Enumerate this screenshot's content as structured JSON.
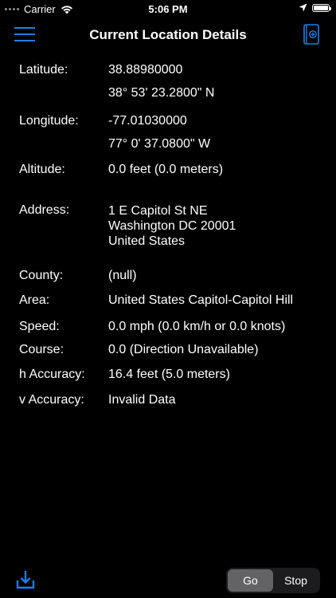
{
  "status_bar": {
    "carrier": "Carrier",
    "time": "5:06 PM",
    "icons": [
      "signal-dots-icon",
      "wifi-icon",
      "location-arrow-icon",
      "battery-icon"
    ]
  },
  "nav": {
    "title": "Current Location Details",
    "left_icon": "menu-icon",
    "right_icon": "add-bookmark-icon",
    "accent_color": "#1e7cf0"
  },
  "details": {
    "latitude": {
      "label": "Latitude:",
      "decimal": "38.88980000",
      "dms": "38° 53' 23.2800\" N"
    },
    "longitude": {
      "label": "Longitude:",
      "decimal": "-77.01030000",
      "dms": "77° 0' 37.0800\" W"
    },
    "altitude": {
      "label": "Altitude:",
      "value": "0.0 feet (0.0 meters)"
    },
    "address": {
      "label": "Address:",
      "line1": "1 E Capitol St NE",
      "line2": "Washington DC 20001",
      "line3": "United States"
    },
    "county": {
      "label": "County:",
      "value": "(null)"
    },
    "area": {
      "label": "Area:",
      "value": "United States Capitol-Capitol Hill"
    },
    "speed": {
      "label": "Speed:",
      "value": "0.0 mph (0.0 km/h or 0.0 knots)"
    },
    "course": {
      "label": "Course:",
      "value": "0.0 (Direction Unavailable)"
    },
    "h_accuracy": {
      "label": "h Accuracy:",
      "value": "16.4 feet (5.0 meters)"
    },
    "v_accuracy": {
      "label": "v Accuracy:",
      "value": "Invalid Data"
    }
  },
  "bottom_bar": {
    "download_icon": "download-icon",
    "segments": [
      {
        "label": "Go",
        "selected": true
      },
      {
        "label": "Stop",
        "selected": false
      }
    ]
  }
}
